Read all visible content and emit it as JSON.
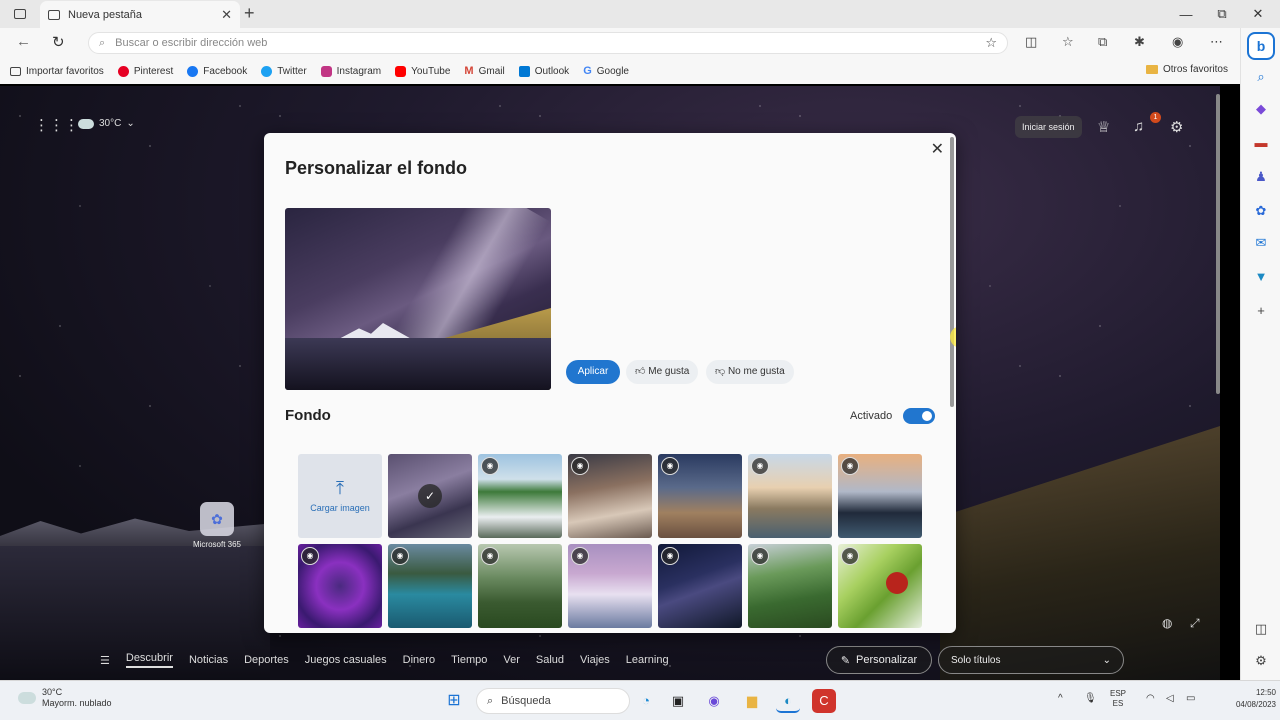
{
  "browser": {
    "tab_title": "Nueva pestaña",
    "tab_close": "✕",
    "new_tab": "+",
    "address_placeholder": "Buscar o escribir dirección web",
    "window_controls": [
      "—",
      "⧉",
      "✕"
    ],
    "bookmarks": [
      {
        "label": "Importar favoritos",
        "color": "#555555"
      },
      {
        "label": "Pinterest",
        "color": "#e60023"
      },
      {
        "label": "Facebook",
        "color": "#1877f2"
      },
      {
        "label": "Twitter",
        "color": "#1da1f2"
      },
      {
        "label": "Instagram",
        "color": "#c13584"
      },
      {
        "label": "YouTube",
        "color": "#ff0000"
      },
      {
        "label": "Gmail",
        "color": "#d44638"
      },
      {
        "label": "Outlook",
        "color": "#0078d4"
      },
      {
        "label": "Google",
        "color": "#4285f4"
      }
    ],
    "other_favorites": "Otros favoritos"
  },
  "page": {
    "weather_temp": "30°C",
    "signin": "Iniciar sesión",
    "notification_count": "1",
    "m365_label": "Microsoft 365",
    "nav": [
      "Descubrir",
      "Noticias",
      "Deportes",
      "Juegos casuales",
      "Dinero",
      "Tiempo",
      "Ver",
      "Salud",
      "Viajes",
      "Learning"
    ],
    "personalize_button": "Personalizar",
    "titles_select": "Solo títulos"
  },
  "dialog": {
    "title": "Personalizar el fondo",
    "apply": "Aplicar",
    "like": "Me gusta",
    "dislike": "No me gusta",
    "section_title": "Fondo",
    "toggle_label": "Activado",
    "upload_label": "Cargar imagen",
    "thumbnails": [
      {
        "bg": "linear-gradient(160deg,#5a5070,#8a7ea0 40%,#3a3550 70%,#6a6a7a)",
        "selected": true,
        "eye": false
      },
      {
        "bg": "linear-gradient(180deg,#9ec3e0 0%,#cfe0ea 30%,#3d7a3a 45%,#eaeef0 75%,#5a6a5a)",
        "selected": false,
        "eye": true
      },
      {
        "bg": "linear-gradient(170deg,#3a3a45 0%,#8a7060 40%,#d8c8b8 70%,#6a5a50)",
        "selected": false,
        "eye": true
      },
      {
        "bg": "linear-gradient(180deg,#2a3a60 0%,#5a6a8a 40%,#a08060 70%,#6a5040)",
        "selected": false,
        "eye": true
      },
      {
        "bg": "linear-gradient(180deg,#c8d8e8 0%,#e8d0b0 40%,#8a7a60 65%,#4a6070)",
        "selected": false,
        "eye": true
      },
      {
        "bg": "linear-gradient(180deg,#e8b080 0%,#b0b8c8 45%,#202a3a 70%,#405a70)",
        "selected": false,
        "eye": true
      },
      {
        "bg": "radial-gradient(circle at 50% 50%,#4a2a80,#8a30c0 40%,#3a1a70 75%,#6a20a0)",
        "selected": false,
        "eye": true
      },
      {
        "bg": "linear-gradient(180deg,#6a8aa0 0%,#3a5a40 35%,#2a8aa0 60%,#1a5a70)",
        "selected": false,
        "eye": true
      },
      {
        "bg": "linear-gradient(180deg,#b8c8b0 0%,#6a8a60 40%,#3a5a30 70%,#2a4a20)",
        "selected": false,
        "eye": true
      },
      {
        "bg": "linear-gradient(180deg,#a890c0 0%,#c8a8d0 35%,#e8e0f0 60%,#6a7aa0)",
        "selected": false,
        "eye": true
      },
      {
        "bg": "linear-gradient(160deg,#101838 0%,#2a3060 40%,#4a4a80 55%,#101828)",
        "selected": false,
        "eye": true
      },
      {
        "bg": "linear-gradient(170deg,#c8d0d8 0%,#6a9a5a 35%,#3a6a30 65%,#2a4a20)",
        "selected": false,
        "eye": true
      },
      {
        "bg": "linear-gradient(135deg,#e8f0d8 0%,#a8d060 35%,#6aa030 60%,#e8f0e0)",
        "selected": false,
        "eye": true,
        "ladybug": true
      }
    ]
  },
  "taskbar": {
    "weather_temp": "30°C",
    "weather_desc": "Mayorm. nublado",
    "search_label": "Búsqueda",
    "lang_line1": "ESP",
    "lang_line2": "ES",
    "time": "12:50",
    "date": "04/08/2023"
  }
}
